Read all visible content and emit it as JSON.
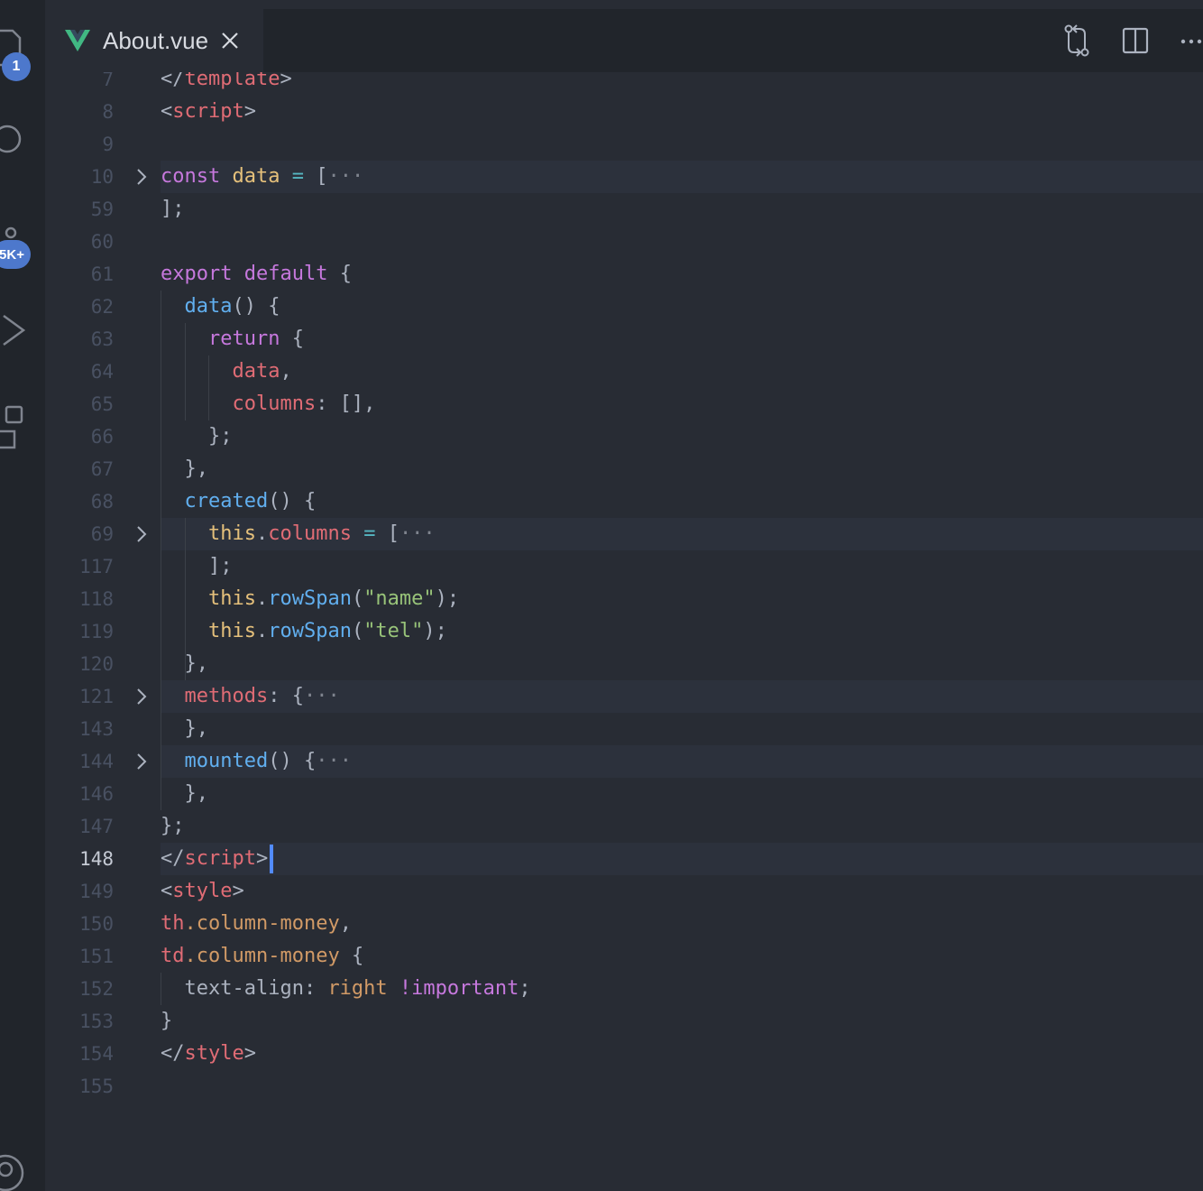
{
  "activity_bar": {
    "explorer_badge": "1",
    "scm_badge": "5K+"
  },
  "tab": {
    "title": "About.vue"
  },
  "editor": {
    "lines": [
      {
        "num": "7",
        "tokens": [
          {
            "text": "</",
            "c": "p"
          },
          {
            "text": "template",
            "c": "t"
          },
          {
            "text": ">",
            "c": "p"
          }
        ]
      },
      {
        "num": "8",
        "tokens": [
          {
            "text": "<",
            "c": "p"
          },
          {
            "text": "script",
            "c": "t"
          },
          {
            "text": ">",
            "c": "p"
          }
        ]
      },
      {
        "num": "9",
        "tokens": []
      },
      {
        "num": "10",
        "fold": true,
        "tokens": [
          {
            "text": "const ",
            "c": "k"
          },
          {
            "text": "data ",
            "c": "v"
          },
          {
            "text": "= ",
            "c": "o"
          },
          {
            "text": "[",
            "c": "p"
          },
          {
            "text": "···",
            "c": "e"
          }
        ]
      },
      {
        "num": "59",
        "tokens": [
          {
            "text": "];",
            "c": "p"
          }
        ]
      },
      {
        "num": "60",
        "tokens": []
      },
      {
        "num": "61",
        "tokens": [
          {
            "text": "export ",
            "c": "k"
          },
          {
            "text": "default ",
            "c": "k"
          },
          {
            "text": "{",
            "c": "p"
          }
        ]
      },
      {
        "num": "62",
        "tokens": [
          {
            "text": "  data",
            "c": "f"
          },
          {
            "text": "() {",
            "c": "p"
          }
        ]
      },
      {
        "num": "63",
        "tokens": [
          {
            "text": "    return ",
            "c": "k"
          },
          {
            "text": "{",
            "c": "p"
          }
        ]
      },
      {
        "num": "64",
        "tokens": [
          {
            "text": "      data",
            "c": "t"
          },
          {
            "text": ",",
            "c": "p"
          }
        ]
      },
      {
        "num": "65",
        "tokens": [
          {
            "text": "      columns",
            "c": "t"
          },
          {
            "text": ": [],",
            "c": "p"
          }
        ]
      },
      {
        "num": "66",
        "tokens": [
          {
            "text": "    };",
            "c": "p"
          }
        ]
      },
      {
        "num": "67",
        "tokens": [
          {
            "text": "  },",
            "c": "p"
          }
        ]
      },
      {
        "num": "68",
        "tokens": [
          {
            "text": "  created",
            "c": "f"
          },
          {
            "text": "() {",
            "c": "p"
          }
        ]
      },
      {
        "num": "69",
        "fold": true,
        "tokens": [
          {
            "text": "    this",
            "c": "v"
          },
          {
            "text": ".",
            "c": "p"
          },
          {
            "text": "columns ",
            "c": "t"
          },
          {
            "text": "= ",
            "c": "o"
          },
          {
            "text": "[",
            "c": "p"
          },
          {
            "text": "···",
            "c": "e"
          }
        ]
      },
      {
        "num": "117",
        "tokens": [
          {
            "text": "    ];",
            "c": "p"
          }
        ]
      },
      {
        "num": "118",
        "tokens": [
          {
            "text": "    this",
            "c": "v"
          },
          {
            "text": ".",
            "c": "p"
          },
          {
            "text": "rowSpan",
            "c": "f"
          },
          {
            "text": "(",
            "c": "p"
          },
          {
            "text": "\"name\"",
            "c": "s"
          },
          {
            "text": ");",
            "c": "p"
          }
        ]
      },
      {
        "num": "119",
        "tokens": [
          {
            "text": "    this",
            "c": "v"
          },
          {
            "text": ".",
            "c": "p"
          },
          {
            "text": "rowSpan",
            "c": "f"
          },
          {
            "text": "(",
            "c": "p"
          },
          {
            "text": "\"tel\"",
            "c": "s"
          },
          {
            "text": ");",
            "c": "p"
          }
        ]
      },
      {
        "num": "120",
        "tokens": [
          {
            "text": "  },",
            "c": "p"
          }
        ]
      },
      {
        "num": "121",
        "fold": true,
        "tokens": [
          {
            "text": "  methods",
            "c": "t"
          },
          {
            "text": ": {",
            "c": "p"
          },
          {
            "text": "···",
            "c": "e"
          }
        ]
      },
      {
        "num": "143",
        "tokens": [
          {
            "text": "  },",
            "c": "p"
          }
        ]
      },
      {
        "num": "144",
        "fold": true,
        "tokens": [
          {
            "text": "  mounted",
            "c": "f"
          },
          {
            "text": "() {",
            "c": "p"
          },
          {
            "text": "···",
            "c": "e"
          }
        ]
      },
      {
        "num": "146",
        "tokens": [
          {
            "text": "  },",
            "c": "p"
          }
        ]
      },
      {
        "num": "147",
        "tokens": [
          {
            "text": "};",
            "c": "p"
          }
        ]
      },
      {
        "num": "148",
        "active": true,
        "cursor": true,
        "tokens": [
          {
            "text": "</",
            "c": "p"
          },
          {
            "text": "script",
            "c": "t"
          },
          {
            "text": ">",
            "c": "p"
          }
        ]
      },
      {
        "num": "149",
        "tokens": [
          {
            "text": "<",
            "c": "p"
          },
          {
            "text": "style",
            "c": "t"
          },
          {
            "text": ">",
            "c": "p"
          }
        ]
      },
      {
        "num": "150",
        "tokens": [
          {
            "text": "th",
            "c": "t"
          },
          {
            "text": ".column-money",
            "c": "c"
          },
          {
            "text": ",",
            "c": "p"
          }
        ]
      },
      {
        "num": "151",
        "tokens": [
          {
            "text": "td",
            "c": "t"
          },
          {
            "text": ".column-money ",
            "c": "c"
          },
          {
            "text": "{",
            "c": "p"
          }
        ]
      },
      {
        "num": "152",
        "tokens": [
          {
            "text": "  text-align: ",
            "c": "p"
          },
          {
            "text": "right ",
            "c": "c"
          },
          {
            "text": "!important",
            "c": "k"
          },
          {
            "text": ";",
            "c": "p"
          }
        ]
      },
      {
        "num": "153",
        "tokens": [
          {
            "text": "}",
            "c": "p"
          }
        ]
      },
      {
        "num": "154",
        "tokens": [
          {
            "text": "</",
            "c": "p"
          },
          {
            "text": "style",
            "c": "t"
          },
          {
            "text": ">",
            "c": "p"
          }
        ]
      },
      {
        "num": "155",
        "tokens": []
      }
    ]
  },
  "icons": {
    "explorer": "files-icon",
    "search": "search-icon",
    "scm": "source-control-icon",
    "run": "run-debug-icon",
    "extensions": "extensions-icon",
    "account": "account-icon",
    "vue": "vue-logo-icon",
    "close": "close-icon",
    "compare": "open-changes-icon",
    "split": "split-editor-icon",
    "more": "more-actions-icon",
    "fold": "chevron-right-icon"
  },
  "colors": {
    "background": "#282c34",
    "accent": "#4d78cc",
    "cursor": "#528bff"
  }
}
